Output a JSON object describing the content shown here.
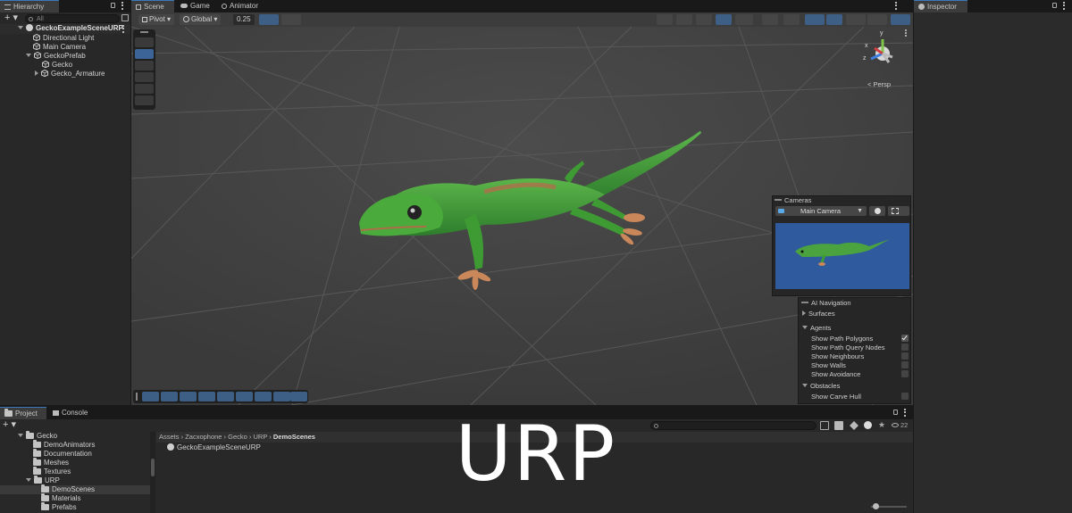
{
  "hierarchy": {
    "tab_label": "Hierarchy",
    "search_placeholder": "All",
    "scene_name": "GeckoExampleSceneURP",
    "items": [
      {
        "label": "Directional Light"
      },
      {
        "label": "Main Camera"
      },
      {
        "label": "GeckoPrefab"
      },
      {
        "label": "Gecko"
      },
      {
        "label": "Gecko_Armature"
      }
    ]
  },
  "scene_tabs": [
    {
      "label": "Scene"
    },
    {
      "label": "Game"
    },
    {
      "label": "Animator"
    }
  ],
  "scene_toolbar": {
    "pivot_label": "Pivot",
    "global_label": "Global",
    "snap_value": "0.25"
  },
  "scene_view": {
    "persp_label": "< Persp",
    "gizmo_axes": {
      "y": "y",
      "x": "x",
      "z": "z"
    }
  },
  "cameras_overlay": {
    "title": "Cameras",
    "selected_camera": "Main Camera"
  },
  "ai_navigation": {
    "title": "AI Navigation",
    "surfaces_label": "Surfaces",
    "agents_label": "Agents",
    "agent_options": [
      {
        "label": "Show Path Polygons",
        "checked": true
      },
      {
        "label": "Show Path Query Nodes",
        "checked": false
      },
      {
        "label": "Show Neighbours",
        "checked": false
      },
      {
        "label": "Show Walls",
        "checked": false
      },
      {
        "label": "Show Avoidance",
        "checked": false
      }
    ],
    "obstacles_label": "Obstacles",
    "obstacle_options": [
      {
        "label": "Show Carve Hull",
        "checked": false
      }
    ]
  },
  "inspector": {
    "tab_label": "Inspector"
  },
  "project": {
    "tabs": [
      {
        "label": "Project"
      },
      {
        "label": "Console"
      }
    ],
    "folders": [
      {
        "label": "Gecko"
      },
      {
        "label": "DemoAnimators"
      },
      {
        "label": "Documentation"
      },
      {
        "label": "Meshes"
      },
      {
        "label": "Textures"
      },
      {
        "label": "URP"
      },
      {
        "label": "DemoScenes"
      },
      {
        "label": "Materials"
      },
      {
        "label": "Prefabs"
      }
    ],
    "breadcrumb": [
      "Assets",
      "Zacxophone",
      "Gecko",
      "URP",
      "DemoScenes"
    ],
    "files": [
      {
        "label": "GeckoExampleSceneURP"
      }
    ],
    "visibility_count": "22"
  },
  "overlay_caption": "URP",
  "colors": {
    "accent": "#3a79bb",
    "gecko_green": "#3f9a3a",
    "camera_bg": "#2f5a9e"
  }
}
